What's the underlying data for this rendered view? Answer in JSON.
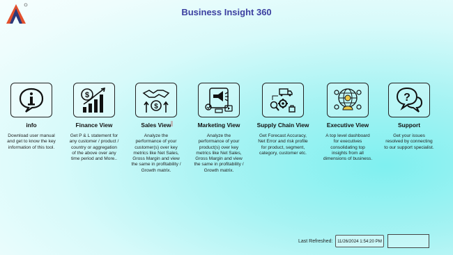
{
  "header": {
    "title": "Business Insight 360",
    "logo": "company-logo"
  },
  "tiles": [
    {
      "label": "info",
      "icon": "info-icon",
      "description": "Download user manual and get to know the key information of this tool."
    },
    {
      "label": "Finance View",
      "icon": "finance-icon",
      "description": "Get  P & L statement for any customer / product / country or aggregation of the above over any time period and More.."
    },
    {
      "label": "Sales View",
      "icon": "sales-icon",
      "description": "Analyze the performance of your customer(s) over key metrics like Net Sales, Gross Margin and view the same in profitability / Growth matrix."
    },
    {
      "label": "Marketing View",
      "icon": "marketing-icon",
      "description": "Analyze the performance of your product(s) over key metrics like Net Sales, Gross Margin and view the same in profitability / Growth matrix."
    },
    {
      "label": "Supply Chain View",
      "icon": "supply-chain-icon",
      "description": "Get Forecast Accuracy, Net Error and risk profile for product, segment, category, customer etc."
    },
    {
      "label": "Executive View",
      "icon": "executive-icon",
      "description": "A top level dashboard for executives consolidating top insights from all dimensions of business."
    },
    {
      "label": "Support",
      "icon": "support-icon",
      "description": "Get your issues resolved by connecting to our support specialist."
    }
  ],
  "footer": {
    "last_refreshed_label": "Last Refreshed:",
    "last_refreshed_value": "11/26/2024 1:54:20 PM"
  }
}
